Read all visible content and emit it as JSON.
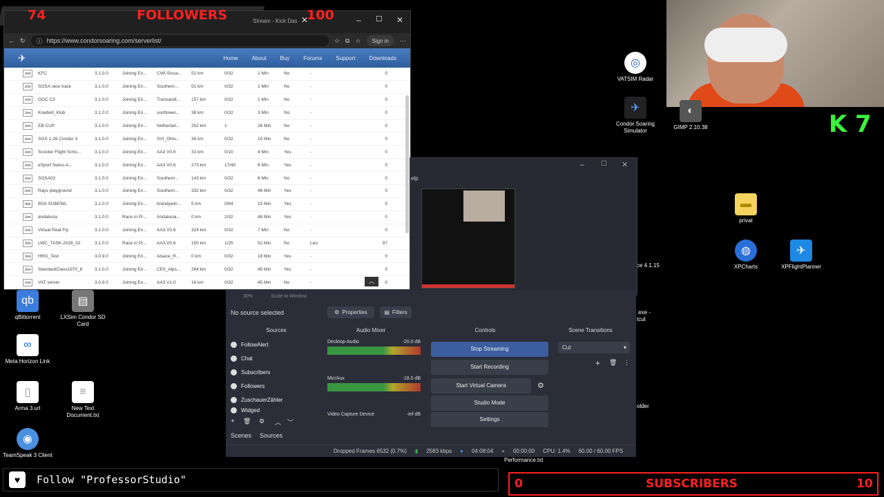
{
  "overlay": {
    "followers_count": "74",
    "followers_label": "FOLLOWERS",
    "followers_goal": "100",
    "subs_count": "0",
    "subs_label": "SUBSCRIBERS",
    "subs_goal": "10",
    "follow_text": "Follow \"ProfessorStudio\"",
    "k_badge": "K 7"
  },
  "browser": {
    "tab_title": "Stream - Kick Das",
    "url": "https://www.condorsoaring.com/serverlist/",
    "sign_in": "Sign in",
    "nav": [
      "Home",
      "About",
      "Buy",
      "Forums",
      "Support",
      "Downloads"
    ],
    "rows": [
      {
        "name": "KFC",
        "ver": "3.1.0.0",
        "status": "Joining En...",
        "scenery": "CWI-Sicsa...",
        "dist": "51 km",
        "players": "0/32",
        "time": "1 Min",
        "pw": "No",
        "extra": "-",
        "count": "0"
      },
      {
        "name": "SOSA race track",
        "ver": "3.1.0.0",
        "status": "Joining En...",
        "scenery": "Southern...",
        "dist": "51 km",
        "players": "0/32",
        "time": "1 Min",
        "pw": "No",
        "extra": "-",
        "count": "0"
      },
      {
        "name": "GGC C3",
        "ver": "3.1.0.0",
        "status": "Joining En...",
        "scenery": "Transandi...",
        "dist": "157 km",
        "players": "0/32",
        "time": "1 Min",
        "pw": "No",
        "extra": "-",
        "count": "0"
      },
      {
        "name": "Kowbell_Klub",
        "ver": "3.1.0.0",
        "status": "Joining En...",
        "scenery": "sunflower...",
        "dist": "36 km",
        "players": "0/32",
        "time": "3 Min",
        "pw": "No",
        "extra": "-",
        "count": "0"
      },
      {
        "name": "EB CUP",
        "ver": "3.1.0.0",
        "status": "Joining En...",
        "scenery": "Netherlan...",
        "dist": "252 km",
        "players": "1",
        "time": "26 Min",
        "pw": "No",
        "extra": "-",
        "count": "0"
      },
      {
        "name": "SGS 1-26 Condor 3",
        "ver": "3.1.0.0",
        "status": "Joining En...",
        "scenery": "SVI_Ohio...",
        "dist": "36 km",
        "players": "0/32",
        "time": "10 Min",
        "pw": "No",
        "extra": "-",
        "count": "0"
      },
      {
        "name": "Scooter Flight Scho...",
        "ver": "3.1.0.0",
        "status": "Joining En...",
        "scenery": "AA3 V0.6",
        "dist": "31 km",
        "players": "0/10",
        "time": "4 Min",
        "pw": "Yes",
        "extra": "-",
        "count": "0"
      },
      {
        "name": "eSport Swiss-A...",
        "ver": "3.1.0.0",
        "status": "Joining En...",
        "scenery": "AA3 V0.6",
        "dist": "273 km",
        "players": "17/40",
        "time": "6 Min",
        "pw": "Yes",
        "extra": "-",
        "count": "0"
      },
      {
        "name": "SOSA02",
        "ver": "3.1.0.0",
        "status": "Joining En...",
        "scenery": "Southern...",
        "dist": "143 km",
        "players": "0/32",
        "time": "6 Min",
        "pw": "No",
        "extra": "-",
        "count": "0"
      },
      {
        "name": "Rays playground",
        "ver": "3.1.0.0",
        "status": "Joining En...",
        "scenery": "Southern...",
        "dist": "332 km",
        "players": "0/32",
        "time": "46 Min",
        "pw": "Yes",
        "extra": "-",
        "count": "0"
      },
      {
        "name": "BSA SUBEWL",
        "ver": "3.1.0.0",
        "status": "Joining En...",
        "scenery": "brandywin...",
        "dist": "5 km",
        "players": "0/64",
        "time": "10 Min",
        "pw": "Yes",
        "extra": "-",
        "count": "0"
      },
      {
        "name": "andalucia",
        "ver": "3.1.0.0",
        "status": "Race in Pr...",
        "scenery": "Andalucia...",
        "dist": "0 km",
        "players": "2/32",
        "time": "48 Min",
        "pw": "Yes",
        "extra": "-",
        "count": "0"
      },
      {
        "name": "Virtual Real Fly",
        "ver": "3.1.0.0",
        "status": "Joining En...",
        "scenery": "AA3 V0.6",
        "dist": "324 km",
        "players": "0/32",
        "time": "7 Min",
        "pw": "No",
        "extra": "-",
        "count": "0"
      },
      {
        "name": "LWC_TASK-2026_02",
        "ver": "3.1.0.0",
        "status": "Race in Pr...",
        "scenery": "AA3 V0.6",
        "dist": "150 km",
        "players": "1/25",
        "time": "52 Min",
        "pw": "No",
        "extra": "Leo",
        "count": "97"
      },
      {
        "name": "HRG_Test",
        "ver": "3.0.9.0",
        "status": "Joining En...",
        "scenery": "Alsace_R...",
        "dist": "0 km",
        "players": "0/32",
        "time": "18 Min",
        "pw": "Yes",
        "extra": "-",
        "count": "0"
      },
      {
        "name": "StandardClass1970_8",
        "ver": "3.1.0.0",
        "status": "Joining En...",
        "scenery": "CEII_Alps...",
        "dist": "264 km",
        "players": "0/32",
        "time": "45 Min",
        "pw": "Yes",
        "extra": "-",
        "count": "0"
      },
      {
        "name": "VAT server",
        "ver": "3.0.9.0",
        "status": "Joining En...",
        "scenery": "AA3 V1.0",
        "dist": "16 km",
        "players": "0/32",
        "time": "45 Min",
        "pw": "No",
        "extra": "-",
        "count": "0"
      }
    ]
  },
  "desktop": {
    "right_icons": [
      {
        "label": "VATSIM Radar",
        "icon": "radar-icon"
      },
      {
        "label": "Condor Soaring Simulator",
        "icon": "glider-icon"
      },
      {
        "label": "GIMP 2.10.38",
        "icon": "gimp-icon"
      },
      {
        "label": "privat",
        "icon": "folder-icon"
      },
      {
        "label": "XPCharts",
        "icon": "globe-icon"
      },
      {
        "label": "XPFlightPlanner",
        "icon": "plane-icon"
      }
    ],
    "left_icons": [
      {
        "label": "qBittorrent",
        "icon": "qb-icon"
      },
      {
        "label": "LXSim Condor SD Card",
        "icon": "sd-icon"
      },
      {
        "label": "Meta Horizon Link",
        "icon": "meta-icon"
      },
      {
        "label": "Arma 3.url",
        "icon": "file-icon"
      },
      {
        "label": "New Text Document.txt",
        "icon": "text-file-icon"
      },
      {
        "label": "TeamSpeak 3 Client",
        "icon": "teamspeak-icon"
      }
    ],
    "partial_labels": [
      "ce 4.1.15",
      ".exe -",
      "tcut",
      "older",
      "Performance.txt"
    ]
  },
  "obs": {
    "scale_label": "Scale to Window",
    "zoom": "30%",
    "no_source": "No source selected",
    "properties": "Properties",
    "filters": "Filters",
    "panels": [
      "Sources",
      "Audio Mixer",
      "Controls",
      "Scene Transitions"
    ],
    "sources": [
      "FollowAlert",
      "Chat",
      "Subscribers",
      "Followers",
      "ZuschauerZähler",
      "Widged"
    ],
    "bottom_tabs": [
      "Scenes",
      "Sources"
    ],
    "mixer": [
      {
        "name": "Desktop-Audio",
        "db": "-20.0 dB"
      },
      {
        "name": "Mic/Aux",
        "db": "-18.0 dB"
      },
      {
        "name": "Video Capture Device",
        "db": "-inf dB"
      }
    ],
    "controls": [
      "Stop Streaming",
      "Start Recording",
      "Start Virtual Camera",
      "Studio Mode",
      "Settings"
    ],
    "transition": "Cut",
    "menu_fragment": "elp",
    "status": {
      "dropped": "Dropped Frames 6532 (0.7%)",
      "kbps": "2583 kbps",
      "live": "04:08:04",
      "rec": "00:00:00",
      "cpu": "CPU: 1.4%",
      "fps": "60.00 / 60.00 FPS"
    }
  },
  "colors": {
    "overlay_red": "#ff2020",
    "obs_bg": "#2b2e38",
    "site_blue": "#3a6db0"
  }
}
